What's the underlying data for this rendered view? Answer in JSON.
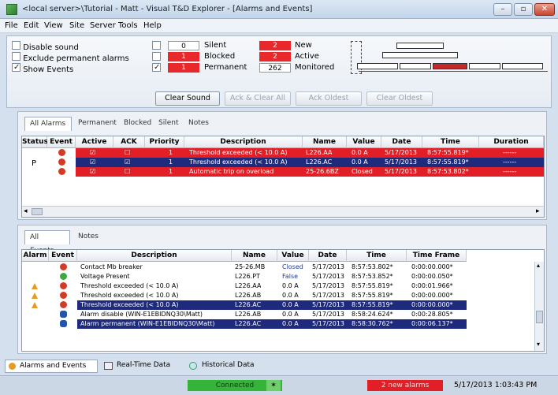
{
  "window": {
    "title": "<local server>\\Tutorial - Matt - Visual T&D Explorer - [Alarms and Events]"
  },
  "menu": [
    "File",
    "Edit",
    "View",
    "Site",
    "Server",
    "Tools",
    "Help"
  ],
  "options": {
    "disable_sound": "Disable sound",
    "exclude_permanent": "Exclude permanent alarms",
    "show_events": "Show Events"
  },
  "counters": {
    "silent": {
      "value": "0",
      "label": "Silent"
    },
    "blocked": {
      "value": "1",
      "label": "Blocked"
    },
    "permanent": {
      "value": "1",
      "label": "Permanent"
    },
    "new": {
      "value": "2",
      "label": "New"
    },
    "active": {
      "value": "2",
      "label": "Active"
    },
    "monitored": {
      "value": "262",
      "label": "Monitored"
    }
  },
  "buttons": {
    "clear_sound": "Clear Sound",
    "ack_clear_all": "Ack & Clear All",
    "ack_oldest": "Ack Oldest",
    "clear_oldest": "Clear Oldest"
  },
  "alarm_tabs": [
    "All Alarms",
    "Permanent",
    "Blocked",
    "Silent",
    "Notes"
  ],
  "alarm_columns": [
    "Status",
    "Event",
    "Active",
    "ACK",
    "Priority",
    "Description",
    "Name",
    "Value",
    "Date",
    "Time",
    "Duration"
  ],
  "alarm_rows": [
    {
      "status": "",
      "active": true,
      "ack": false,
      "priority": "1",
      "description": "Threshold exceeded (< 10.0 A)",
      "name": "L226.AA",
      "value": "0.0 A",
      "date": "5/17/2013",
      "time": "8:57:55.819*",
      "duration": "------",
      "style": "red"
    },
    {
      "status": "P",
      "active": true,
      "ack": true,
      "priority": "1",
      "description": "Threshold exceeded (< 10.0 A)",
      "name": "L226.AC",
      "value": "0.0 A",
      "date": "5/17/2013",
      "time": "8:57:55.819*",
      "duration": "------",
      "style": "blue"
    },
    {
      "status": "",
      "active": true,
      "ack": false,
      "priority": "1",
      "description": "Automatic trip on overload",
      "name": "25-26.6BZ",
      "value": "Closed",
      "date": "5/17/2013",
      "time": "8:57:53.802*",
      "duration": "------",
      "style": "red"
    }
  ],
  "event_tabs": [
    "All Events",
    "Notes"
  ],
  "event_columns": [
    "Alarm",
    "Event",
    "Description",
    "Name",
    "Value",
    "Date",
    "Time",
    "Time Frame"
  ],
  "event_rows": [
    {
      "description": "Contact Mb breaker",
      "name": "25-26.MB",
      "value": "Closed",
      "date": "5/17/2013",
      "time": "8:57:53.802*",
      "frame": "0:00:00.000*",
      "icon": "red",
      "bell": false,
      "style": ""
    },
    {
      "description": "Voltage Present",
      "name": "L226.PT",
      "value": "False",
      "date": "5/17/2013",
      "time": "8:57:53.852*",
      "frame": "0:00:00.050*",
      "icon": "green",
      "bell": false,
      "style": ""
    },
    {
      "description": "Threshold exceeded (< 10.0 A)",
      "name": "L226.AA",
      "value": "0.0 A",
      "date": "5/17/2013",
      "time": "8:57:55.819*",
      "frame": "0:00:01.966*",
      "icon": "red",
      "bell": true,
      "style": ""
    },
    {
      "description": "Threshold exceeded (< 10.0 A)",
      "name": "L226.AB",
      "value": "0.0 A",
      "date": "5/17/2013",
      "time": "8:57:55.819*",
      "frame": "0:00:00.000*",
      "icon": "red",
      "bell": true,
      "style": ""
    },
    {
      "description": "Threshold exceeded (< 10.0 A)",
      "name": "L226.AC",
      "value": "0.0 A",
      "date": "5/17/2013",
      "time": "8:57:55.819*",
      "frame": "0:00:00.000*",
      "icon": "red",
      "bell": true,
      "style": "blue"
    },
    {
      "description": "Alarm disable (WIN-E1EBIDNQ30\\Matt)",
      "name": "L226.AB",
      "value": "0.0 A",
      "date": "5/17/2013",
      "time": "8:58:24.624*",
      "frame": "0:00:28.805*",
      "icon": "blue",
      "bell": false,
      "style": ""
    },
    {
      "description": "Alarm permanent (WIN-E1EBIDNQ30\\Matt)",
      "name": "L226.AC",
      "value": "0.0 A",
      "date": "5/17/2013",
      "time": "8:58:30.762*",
      "frame": "0:00:06.137*",
      "icon": "blue",
      "bell": false,
      "style": "blue"
    }
  ],
  "bottom_tabs": [
    "Alarms and Events",
    "Real-Time Data",
    "Historical Data"
  ],
  "status": {
    "connection": "Connected",
    "new_alarms": "2 new alarms",
    "datetime": "5/17/2013 1:03:43 PM"
  },
  "colors": {
    "alarm_red": "#e21f26",
    "alarm_blue": "#1e2a7c",
    "connected_green": "#35b43a"
  }
}
